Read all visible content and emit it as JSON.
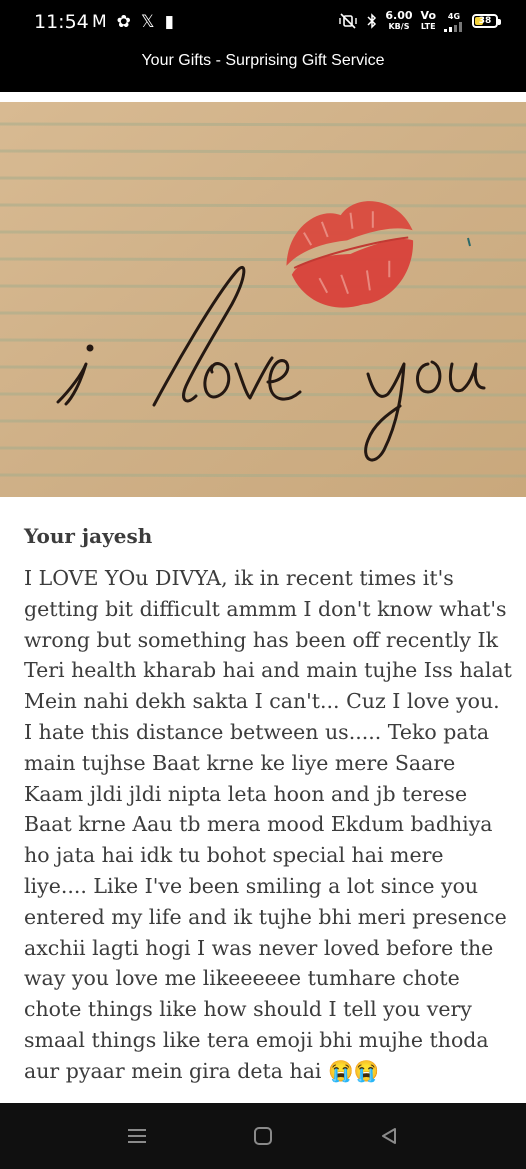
{
  "status_bar": {
    "time": "11:54",
    "notification_icons": [
      "M",
      "✿",
      "𝕏",
      "▮"
    ],
    "net_speed_value": "6.00",
    "net_speed_unit": "KB/S",
    "volte_label": "Vo",
    "volte_sub": "LTE",
    "network_type": "4G",
    "battery_level": "38",
    "battery_fraction": 0.38
  },
  "app": {
    "title": "Your Gifts - Surprising Gift Service"
  },
  "photo": {
    "handwriting": "i love you"
  },
  "card": {
    "author": "Your jayesh",
    "message": "I LOVE YOu DIVYA, ik in recent times it's getting bit difficult ammm I don't know what's wrong but something has been off recently Ik Teri health kharab hai and main tujhe Iss halat Mein nahi dekh sakta I can't... Cuz I love you. I hate this distance between us..... Teko pata main tujhse Baat krne ke liye mere Saare Kaam jldi jldi nipta leta hoon and jb terese Baat krne Aau tb mera mood Ekdum badhiya ho jata hai idk tu bohot special hai mere liye.... Like I've been smiling a lot since you entered my life and ik tujhe bhi meri presence axchii lagti hogi I was never loved before the way you love me likeeeeee tumhare chote chote things like how should I tell you very smaal things like tera emoji bhi mujhe thoda aur pyaar mein gira deta hai 😭😭"
  },
  "nav_bar": {
    "buttons": [
      "menu-icon",
      "home-icon",
      "back-icon"
    ]
  },
  "colors": {
    "status_bg": "#000000",
    "paper": "#d2b38a",
    "ink": "#241812",
    "lipstick": "#d8413a",
    "text": "#3c3c3c",
    "nav_bg": "#101010"
  }
}
